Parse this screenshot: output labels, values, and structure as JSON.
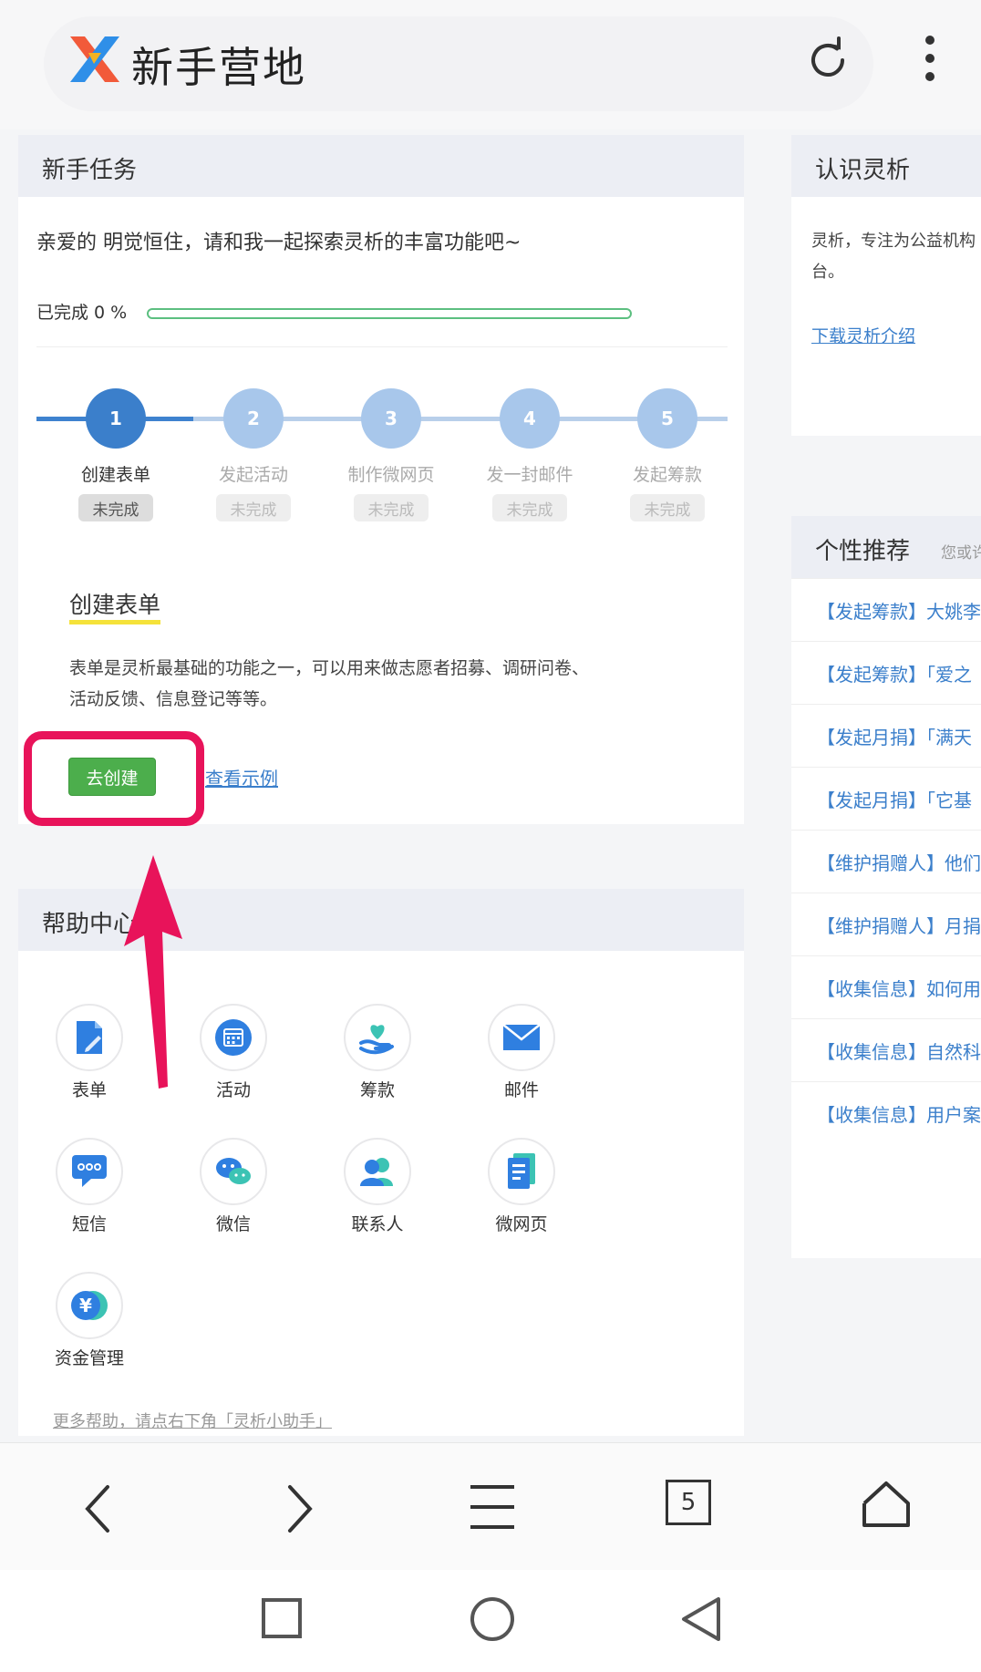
{
  "header": {
    "title": "新手营地",
    "refresh_icon": "refresh-icon",
    "menu_icon": "more-vertical-icon"
  },
  "tasks": {
    "title": "新手任务",
    "greeting": "亲爱的 明觉恒住，请和我一起探索灵析的丰富功能吧~",
    "progress_label": "已完成 0 %",
    "progress": 0,
    "steps": [
      {
        "num": "1",
        "name": "创建表单",
        "status": "未完成"
      },
      {
        "num": "2",
        "name": "发起活动",
        "status": "未完成"
      },
      {
        "num": "3",
        "name": "制作微网页",
        "status": "未完成"
      },
      {
        "num": "4",
        "name": "发一封邮件",
        "status": "未完成"
      },
      {
        "num": "5",
        "name": "发起筹款",
        "status": "未完成"
      }
    ],
    "section_title": "创建表单",
    "section_desc": "表单是灵析最基础的功能之一，可以用来做志愿者招募、调研问卷、活动反馈、信息登记等等。",
    "create_button": "去创建",
    "example_link": "查看示例"
  },
  "help": {
    "title": "帮助中心",
    "items": [
      {
        "label": "表单",
        "icon": "form-icon"
      },
      {
        "label": "活动",
        "icon": "calendar-icon"
      },
      {
        "label": "筹款",
        "icon": "donation-icon"
      },
      {
        "label": "邮件",
        "icon": "mail-icon"
      },
      {
        "label": "短信",
        "icon": "sms-icon"
      },
      {
        "label": "微信",
        "icon": "wechat-icon"
      },
      {
        "label": "联系人",
        "icon": "contacts-icon"
      },
      {
        "label": "微网页",
        "icon": "webpage-icon"
      },
      {
        "label": "资金管理",
        "icon": "finance-icon"
      }
    ],
    "footer": "更多帮助，请点右下角「灵析小助手」"
  },
  "know": {
    "title": "认识灵析",
    "text_line1": "灵析，专注为公益机构",
    "text_line2": "台。",
    "link": "下载灵析介绍"
  },
  "recommend": {
    "title": "个性推荐",
    "subtitle": "您或许",
    "items": [
      "【发起筹款】大姚李",
      "【发起筹款】「爱之",
      "【发起月捐】「满天",
      "【发起月捐】「它基",
      "【维护捐赠人】他们",
      "【维护捐赠人】月捐",
      "【收集信息】如何用",
      "【收集信息】自然科",
      "【收集信息】用户案"
    ]
  },
  "browser": {
    "tabs_count": "5"
  },
  "colors": {
    "primary": "#3b7fcb",
    "success": "#4cae4c",
    "highlight": "#e8135a",
    "underline": "#f5e23a"
  }
}
